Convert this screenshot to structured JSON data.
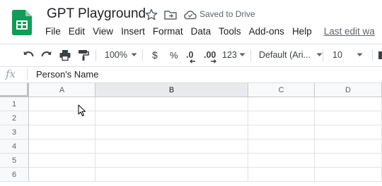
{
  "doc": {
    "title": "GPT Playground",
    "saved_status": "Saved to Drive"
  },
  "menu": [
    "File",
    "Edit",
    "View",
    "Insert",
    "Format",
    "Data",
    "Tools",
    "Add-ons",
    "Help"
  ],
  "last_edit": "Last edit wa",
  "toolbar": {
    "zoom": "100%",
    "currency": "$",
    "percent": "%",
    "decrease_decimal": ".0",
    "increase_decimal": ".00",
    "more_formats": "123",
    "font": "Default (Ari...",
    "font_size": "10"
  },
  "formula_bar": {
    "fx": "fx",
    "value": "Person's Name"
  },
  "columns": [
    "A",
    "B",
    "C",
    "D"
  ],
  "rows": [
    "1",
    "2",
    "3",
    "4",
    "5",
    "6"
  ],
  "colors": {
    "sheets_green": "#0f9d58",
    "selected_header": "#e8eaed"
  }
}
